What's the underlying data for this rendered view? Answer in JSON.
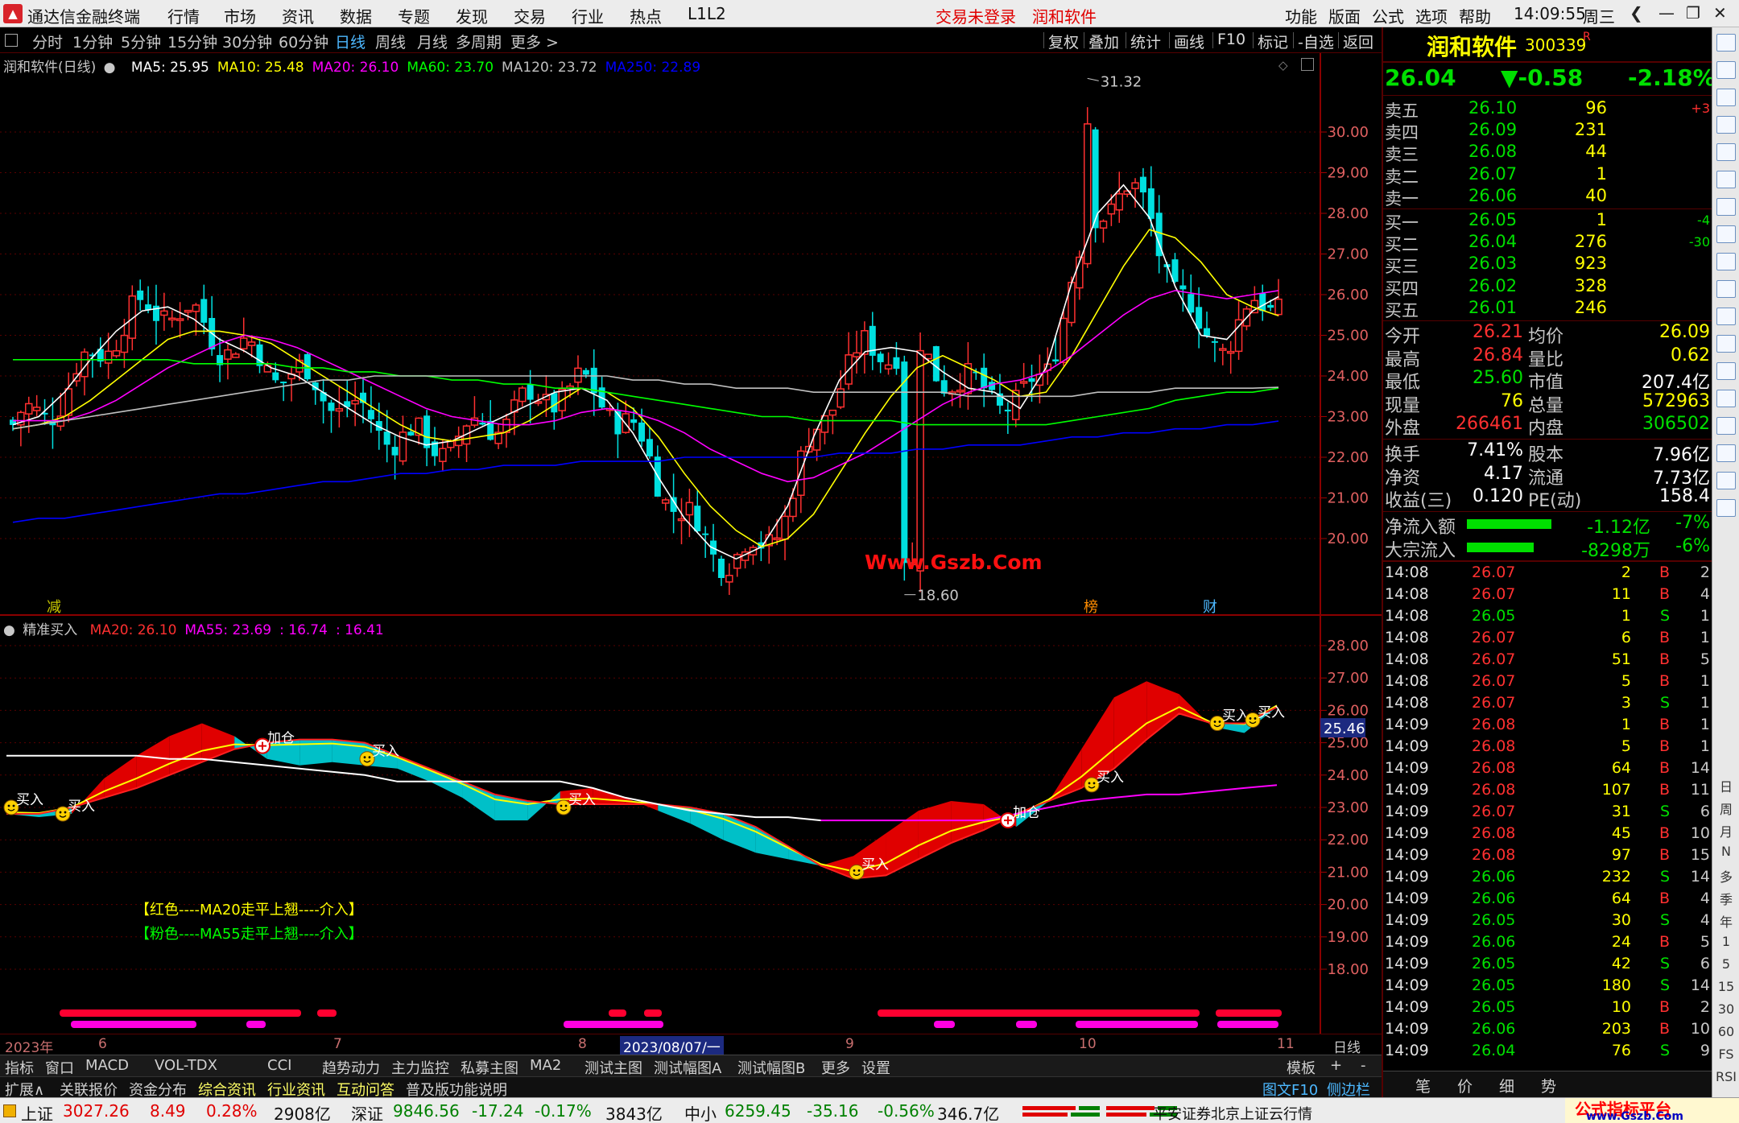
{
  "menubar": {
    "app_name": "通达信金融终端",
    "items": [
      "行情",
      "市场",
      "资讯",
      "数据",
      "专题",
      "发现",
      "交易",
      "行业",
      "热点",
      "L1L2"
    ],
    "notice_trade": "交易未登录",
    "notice_stock": "润和软件",
    "right_items": [
      "功能",
      "版面",
      "公式",
      "选项",
      "帮助"
    ],
    "time": "14:09:55",
    "weekday": "周三"
  },
  "periods": [
    "分时",
    "1分钟",
    "5分钟",
    "15分钟",
    "30分钟",
    "60分钟",
    "日线",
    "周线",
    "月线",
    "多周期",
    "更多 >"
  ],
  "active_period": "日线",
  "tools": [
    "复权",
    "叠加",
    "统计",
    "画线",
    "F10",
    "标记",
    "-自选",
    "返回"
  ],
  "main_chart": {
    "title": "润和软件(日线)",
    "indicators": [
      {
        "label": "MA5: 25.95",
        "color": "#ffffff"
      },
      {
        "label": "MA10: 25.48",
        "color": "#ffff00"
      },
      {
        "label": "MA20: 26.10",
        "color": "#ff00ff"
      },
      {
        "label": "MA60: 23.70",
        "color": "#00ff00"
      },
      {
        "label": "MA120: 23.72",
        "color": "#c0c0c0"
      },
      {
        "label": "MA250: 22.89",
        "color": "#0000ff"
      }
    ],
    "high_label": "31.32",
    "low_label": "18.60",
    "watermark": "Www.Gszb.Com",
    "marks": [
      "减",
      "榜",
      "财"
    ]
  },
  "chart_data": [
    {
      "type": "candlestick",
      "title": "润和软件(日线)",
      "ylim": [
        19.2,
        31.5
      ],
      "yticks": [
        20.0,
        21.0,
        22.0,
        23.0,
        24.0,
        25.0,
        26.0,
        27.0,
        28.0,
        29.0,
        30.0
      ],
      "high": 31.32,
      "low": 18.6,
      "series": [
        {
          "name": "MA5",
          "color": "#ffffff",
          "values": [
            22.8,
            23.0,
            23.6,
            24.4,
            25.1,
            25.6,
            25.7,
            25.4,
            24.9,
            24.6,
            24.2,
            24.0,
            23.6,
            23.2,
            22.8,
            22.5,
            22.3,
            22.4,
            22.7,
            23.0,
            23.3,
            23.6,
            23.7,
            23.4,
            22.6,
            21.5,
            20.5,
            19.8,
            19.5,
            19.8,
            20.8,
            22.5,
            23.9,
            24.6,
            24.7,
            24.6,
            24.1,
            23.7,
            23.6,
            23.2,
            24.2,
            26.3,
            28.0,
            28.7,
            27.9,
            26.2,
            25.0,
            24.9,
            25.6,
            25.95
          ]
        },
        {
          "name": "MA10",
          "color": "#ffff00",
          "values": [
            22.7,
            22.8,
            23.0,
            23.4,
            23.9,
            24.4,
            24.9,
            25.1,
            25.1,
            25.0,
            24.8,
            24.4,
            24.0,
            23.6,
            23.2,
            22.8,
            22.5,
            22.4,
            22.5,
            22.6,
            22.9,
            23.3,
            23.7,
            23.6,
            23.2,
            22.5,
            21.6,
            20.8,
            20.2,
            19.8,
            20.0,
            20.6,
            21.6,
            22.6,
            23.5,
            24.2,
            24.5,
            24.2,
            23.9,
            23.5,
            23.6,
            24.5,
            25.6,
            26.7,
            27.6,
            27.4,
            26.8,
            26.0,
            25.7,
            25.48
          ]
        },
        {
          "name": "MA20",
          "color": "#ff00ff",
          "values": [
            22.9,
            22.9,
            22.9,
            23.1,
            23.4,
            23.8,
            24.2,
            24.5,
            24.8,
            25.0,
            24.9,
            24.7,
            24.4,
            24.1,
            23.8,
            23.5,
            23.2,
            23.0,
            22.9,
            22.8,
            22.8,
            22.9,
            23.1,
            23.2,
            23.1,
            22.9,
            22.6,
            22.2,
            21.9,
            21.6,
            21.4,
            21.5,
            21.8,
            22.1,
            22.5,
            22.9,
            23.3,
            23.6,
            23.8,
            23.9,
            24.1,
            24.5,
            25.0,
            25.5,
            25.9,
            26.1,
            26.0,
            25.9,
            26.0,
            26.1
          ]
        },
        {
          "name": "MA60",
          "color": "#00ff00",
          "values": [
            24.4,
            24.4,
            24.4,
            24.4,
            24.4,
            24.4,
            24.4,
            24.3,
            24.3,
            24.3,
            24.3,
            24.2,
            24.2,
            24.1,
            24.1,
            24.0,
            24.0,
            23.9,
            23.9,
            23.8,
            23.8,
            23.7,
            23.7,
            23.6,
            23.5,
            23.4,
            23.3,
            23.2,
            23.1,
            23.0,
            23.0,
            22.9,
            22.9,
            22.9,
            22.9,
            22.8,
            22.8,
            22.8,
            22.8,
            22.8,
            22.8,
            22.9,
            23.0,
            23.1,
            23.2,
            23.4,
            23.5,
            23.6,
            23.6,
            23.7
          ]
        },
        {
          "name": "MA120",
          "color": "#c0c0c0",
          "values": [
            22.7,
            22.8,
            22.9,
            23.0,
            23.1,
            23.2,
            23.3,
            23.4,
            23.5,
            23.6,
            23.7,
            23.8,
            23.9,
            23.9,
            24.0,
            24.0,
            24.0,
            24.0,
            24.0,
            24.0,
            24.0,
            24.0,
            24.0,
            24.0,
            23.9,
            23.9,
            23.8,
            23.8,
            23.7,
            23.7,
            23.7,
            23.6,
            23.6,
            23.6,
            23.6,
            23.6,
            23.6,
            23.5,
            23.5,
            23.5,
            23.5,
            23.5,
            23.6,
            23.6,
            23.6,
            23.7,
            23.7,
            23.7,
            23.7,
            23.72
          ]
        },
        {
          "name": "MA250",
          "color": "#0000ff",
          "values": [
            20.4,
            20.5,
            20.5,
            20.6,
            20.7,
            20.8,
            20.9,
            21.0,
            21.1,
            21.1,
            21.2,
            21.3,
            21.4,
            21.4,
            21.5,
            21.6,
            21.6,
            21.7,
            21.7,
            21.8,
            21.8,
            21.8,
            21.9,
            21.9,
            21.9,
            21.9,
            22.0,
            22.0,
            22.0,
            22.0,
            22.0,
            22.0,
            22.1,
            22.1,
            22.1,
            22.2,
            22.2,
            22.3,
            22.3,
            22.3,
            22.4,
            22.5,
            22.5,
            22.6,
            22.6,
            22.7,
            22.7,
            22.8,
            22.8,
            22.89
          ]
        }
      ]
    },
    {
      "type": "line",
      "title": "精准买入",
      "ylim": [
        17.5,
        28.6
      ],
      "yticks": [
        18.0,
        19.0,
        20.0,
        21.0,
        22.0,
        23.0,
        24.0,
        25.0,
        26.0,
        27.0,
        28.0
      ],
      "current": "25.46",
      "series": [
        {
          "name": "MA20",
          "color": "#ff2020",
          "values": [
            22.8,
            22.8,
            23.0,
            23.3,
            23.6,
            24.0,
            24.4,
            24.8,
            25.0,
            25.1,
            25.1,
            25.0,
            24.6,
            24.2,
            23.8,
            23.4,
            23.2,
            23.1,
            23.1,
            23.1,
            23.1,
            23.0,
            22.8,
            22.4,
            21.8,
            21.2,
            20.8,
            20.9,
            21.4,
            21.9,
            22.3,
            22.8,
            23.2,
            23.6,
            24.2,
            25.1,
            25.9,
            25.6,
            25.6,
            26.1
          ]
        },
        {
          "name": "MA55",
          "color": "#ffffff",
          "values": [
            24.6,
            24.6,
            24.6,
            24.6,
            24.6,
            24.5,
            24.5,
            24.4,
            24.3,
            24.2,
            24.1,
            24.0,
            23.8,
            23.8,
            23.8,
            23.8,
            23.8,
            23.8,
            23.6,
            23.3,
            23.1,
            22.9,
            22.8,
            22.7,
            22.7,
            22.6,
            22.6,
            22.6,
            22.6,
            22.6,
            22.6,
            22.8,
            23.0,
            23.2,
            23.3,
            23.4,
            23.4,
            23.5,
            23.6,
            23.69
          ]
        }
      ]
    }
  ],
  "sub_chart": {
    "title": "精准买入",
    "indicators": [
      {
        "label": "MA20: 26.10",
        "color": "#ff3030"
      },
      {
        "label": "MA55: 23.69",
        "color": "#ff00ff"
      },
      {
        "label": ": 16.74",
        "color": "#ff00ff"
      },
      {
        "label": ": 16.41",
        "color": "#ff00ff"
      }
    ],
    "signals": [
      "买入",
      "买入",
      "加仓",
      "买入",
      "买入",
      "买入",
      "加仓",
      "买入",
      "买入",
      "买入"
    ],
    "legend1": "【红色----MA20走平上翘----介入】",
    "legend2": "【粉色----MA55走平上翘----介入】",
    "current": "25.46"
  },
  "xaxis": {
    "labels": [
      "2023年",
      "6",
      "7",
      "8",
      "2023/08/07/一",
      "9",
      "10",
      "11"
    ],
    "period": "日线"
  },
  "tabs1": [
    "指标",
    "窗口",
    "MACD",
    "VOL-TDX",
    "CCI",
    "趋势动力",
    "主力监控",
    "私募主图",
    "MA2",
    "测试主图",
    "测试幅图A",
    "测试幅图B",
    "更多",
    "设置"
  ],
  "tabs1_right": [
    "模板",
    "+",
    "-"
  ],
  "tabs2": [
    "扩展∧",
    "关联报价",
    "资金分布",
    "综合资讯",
    "行业资讯",
    "互动问答",
    "普及版功能说明"
  ],
  "tabs2_right": [
    "图文F10",
    "侧边栏《"
  ],
  "panel": {
    "name": "润和软件",
    "code": "300339",
    "badge": "R",
    "price": "26.04",
    "change": "▼-0.58",
    "pct": "-2.18%",
    "asks": [
      {
        "label": "卖五",
        "price": "26.10",
        "vol": "96",
        "chg": "+3"
      },
      {
        "label": "卖四",
        "price": "26.09",
        "vol": "231",
        "chg": ""
      },
      {
        "label": "卖三",
        "price": "26.08",
        "vol": "44",
        "chg": ""
      },
      {
        "label": "卖二",
        "price": "26.07",
        "vol": "1",
        "chg": ""
      },
      {
        "label": "卖一",
        "price": "26.06",
        "vol": "40",
        "chg": ""
      }
    ],
    "bids": [
      {
        "label": "买一",
        "price": "26.05",
        "vol": "1",
        "chg": "-4"
      },
      {
        "label": "买二",
        "price": "26.04",
        "vol": "276",
        "chg": "-30"
      },
      {
        "label": "买三",
        "price": "26.03",
        "vol": "923",
        "chg": ""
      },
      {
        "label": "买四",
        "price": "26.02",
        "vol": "328",
        "chg": ""
      },
      {
        "label": "买五",
        "price": "26.01",
        "vol": "246",
        "chg": ""
      }
    ],
    "stats": [
      {
        "l1": "今开",
        "v1": "26.21",
        "c1": "#ff3030",
        "l2": "均价",
        "v2": "26.09",
        "c2": "#ffff00"
      },
      {
        "l1": "最高",
        "v1": "26.84",
        "c1": "#ff3030",
        "l2": "量比",
        "v2": "0.62",
        "c2": "#ffff00"
      },
      {
        "l1": "最低",
        "v1": "25.60",
        "c1": "#00e000",
        "l2": "市值",
        "v2": "207.4亿",
        "c2": "#ffffff"
      },
      {
        "l1": "现量",
        "v1": "76",
        "c1": "#ffff00",
        "l2": "总量",
        "v2": "572963",
        "c2": "#ffff00"
      },
      {
        "l1": "外盘",
        "v1": "266461",
        "c1": "#ff3030",
        "l2": "内盘",
        "v2": "306502",
        "c2": "#00e000"
      },
      {
        "l1": "换手",
        "v1": "7.41%",
        "c1": "#ffffff",
        "l2": "股本",
        "v2": "7.96亿",
        "c2": "#ffffff"
      },
      {
        "l1": "净资",
        "v1": "4.17",
        "c1": "#ffffff",
        "l2": "流通",
        "v2": "7.73亿",
        "c2": "#ffffff"
      },
      {
        "l1": "收益(三)",
        "v1": "0.120",
        "c1": "#ffffff",
        "l2": "PE(动)",
        "v2": "158.4",
        "c2": "#ffffff"
      }
    ],
    "flows": [
      {
        "label": "净流入额",
        "amount": "-1.12亿",
        "pct": "-7%",
        "bar": 0.7
      },
      {
        "label": "大宗流入",
        "amount": "-8298万",
        "pct": "-6%",
        "bar": 0.55
      }
    ],
    "ticks": [
      [
        "14:08",
        "26.07",
        "2",
        "B",
        "2"
      ],
      [
        "14:08",
        "26.07",
        "11",
        "B",
        "4"
      ],
      [
        "14:08",
        "26.05",
        "1",
        "S",
        "1"
      ],
      [
        "14:08",
        "26.07",
        "6",
        "B",
        "1"
      ],
      [
        "14:08",
        "26.07",
        "51",
        "B",
        "5"
      ],
      [
        "14:08",
        "26.07",
        "5",
        "B",
        "1"
      ],
      [
        "14:08",
        "26.07",
        "3",
        "S",
        "1"
      ],
      [
        "14:09",
        "26.08",
        "1",
        "B",
        "1"
      ],
      [
        "14:09",
        "26.08",
        "5",
        "B",
        "1"
      ],
      [
        "14:09",
        "26.08",
        "64",
        "B",
        "14"
      ],
      [
        "14:09",
        "26.08",
        "107",
        "B",
        "11"
      ],
      [
        "14:09",
        "26.07",
        "31",
        "S",
        "6"
      ],
      [
        "14:09",
        "26.08",
        "45",
        "B",
        "10"
      ],
      [
        "14:09",
        "26.08",
        "97",
        "B",
        "15"
      ],
      [
        "14:09",
        "26.06",
        "232",
        "S",
        "14"
      ],
      [
        "14:09",
        "26.06",
        "64",
        "B",
        "4"
      ],
      [
        "14:09",
        "26.05",
        "30",
        "S",
        "4"
      ],
      [
        "14:09",
        "26.06",
        "24",
        "B",
        "5"
      ],
      [
        "14:09",
        "26.05",
        "42",
        "S",
        "6"
      ],
      [
        "14:09",
        "26.05",
        "180",
        "S",
        "14"
      ],
      [
        "14:09",
        "26.05",
        "10",
        "B",
        "2"
      ],
      [
        "14:09",
        "26.06",
        "203",
        "B",
        "10"
      ],
      [
        "14:09",
        "26.04",
        "76",
        "S",
        "9"
      ]
    ],
    "bottom_tabs": [
      "笔",
      "价",
      "细",
      "势"
    ]
  },
  "side_labels": [
    "日",
    "周",
    "月",
    "N",
    "多",
    "季",
    "年",
    "1",
    "5",
    "15",
    "30",
    "60",
    "FS",
    "RSI"
  ],
  "statusbar": {
    "sh_label": "上证",
    "sh_val": "3027.26",
    "sh_chg": "8.49",
    "sh_pct": "0.28%",
    "sh_amt": "2908亿",
    "sz_label": "深证",
    "sz_val": "9846.56",
    "sz_chg": "-17.24",
    "sz_pct": "-0.17%",
    "sz_amt": "3843亿",
    "zx_label": "中小",
    "zx_val": "6259.45",
    "zx_chg": "-35.16",
    "zx_pct": "-0.56%",
    "zx_amt": "346.7亿",
    "broker": "平安证券北京上证云行情",
    "watermark": "公式指标平台",
    "watermark_url": "www.Gszb.Com"
  },
  "colors": {
    "up": "#ff3030",
    "down": "#00e0e0",
    "grid": "#5a0000",
    "text_red": "#ff3030",
    "text_green": "#00e000"
  }
}
